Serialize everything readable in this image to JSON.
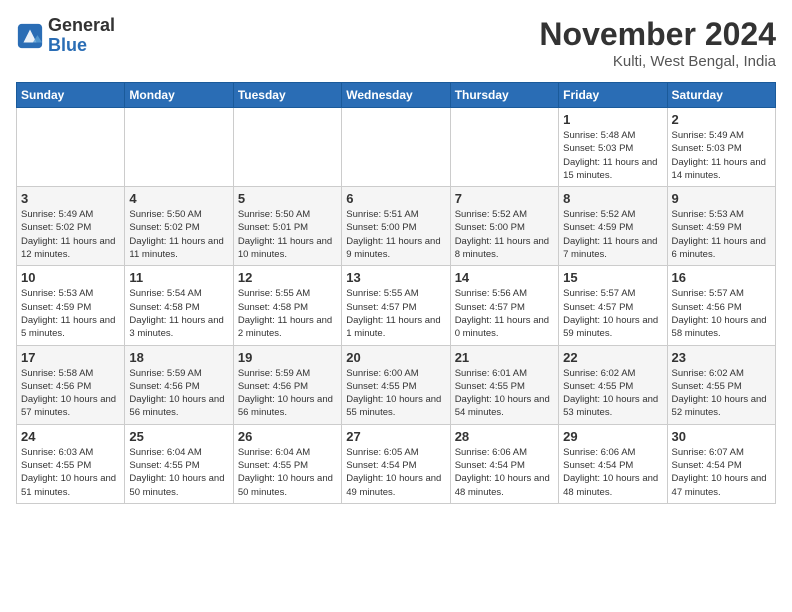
{
  "header": {
    "logo_general": "General",
    "logo_blue": "Blue",
    "title": "November 2024",
    "location": "Kulti, West Bengal, India"
  },
  "days_of_week": [
    "Sunday",
    "Monday",
    "Tuesday",
    "Wednesday",
    "Thursday",
    "Friday",
    "Saturday"
  ],
  "weeks": [
    [
      {
        "day": "",
        "info": ""
      },
      {
        "day": "",
        "info": ""
      },
      {
        "day": "",
        "info": ""
      },
      {
        "day": "",
        "info": ""
      },
      {
        "day": "",
        "info": ""
      },
      {
        "day": "1",
        "info": "Sunrise: 5:48 AM\nSunset: 5:03 PM\nDaylight: 11 hours and 15 minutes."
      },
      {
        "day": "2",
        "info": "Sunrise: 5:49 AM\nSunset: 5:03 PM\nDaylight: 11 hours and 14 minutes."
      }
    ],
    [
      {
        "day": "3",
        "info": "Sunrise: 5:49 AM\nSunset: 5:02 PM\nDaylight: 11 hours and 12 minutes."
      },
      {
        "day": "4",
        "info": "Sunrise: 5:50 AM\nSunset: 5:02 PM\nDaylight: 11 hours and 11 minutes."
      },
      {
        "day": "5",
        "info": "Sunrise: 5:50 AM\nSunset: 5:01 PM\nDaylight: 11 hours and 10 minutes."
      },
      {
        "day": "6",
        "info": "Sunrise: 5:51 AM\nSunset: 5:00 PM\nDaylight: 11 hours and 9 minutes."
      },
      {
        "day": "7",
        "info": "Sunrise: 5:52 AM\nSunset: 5:00 PM\nDaylight: 11 hours and 8 minutes."
      },
      {
        "day": "8",
        "info": "Sunrise: 5:52 AM\nSunset: 4:59 PM\nDaylight: 11 hours and 7 minutes."
      },
      {
        "day": "9",
        "info": "Sunrise: 5:53 AM\nSunset: 4:59 PM\nDaylight: 11 hours and 6 minutes."
      }
    ],
    [
      {
        "day": "10",
        "info": "Sunrise: 5:53 AM\nSunset: 4:59 PM\nDaylight: 11 hours and 5 minutes."
      },
      {
        "day": "11",
        "info": "Sunrise: 5:54 AM\nSunset: 4:58 PM\nDaylight: 11 hours and 3 minutes."
      },
      {
        "day": "12",
        "info": "Sunrise: 5:55 AM\nSunset: 4:58 PM\nDaylight: 11 hours and 2 minutes."
      },
      {
        "day": "13",
        "info": "Sunrise: 5:55 AM\nSunset: 4:57 PM\nDaylight: 11 hours and 1 minute."
      },
      {
        "day": "14",
        "info": "Sunrise: 5:56 AM\nSunset: 4:57 PM\nDaylight: 11 hours and 0 minutes."
      },
      {
        "day": "15",
        "info": "Sunrise: 5:57 AM\nSunset: 4:57 PM\nDaylight: 10 hours and 59 minutes."
      },
      {
        "day": "16",
        "info": "Sunrise: 5:57 AM\nSunset: 4:56 PM\nDaylight: 10 hours and 58 minutes."
      }
    ],
    [
      {
        "day": "17",
        "info": "Sunrise: 5:58 AM\nSunset: 4:56 PM\nDaylight: 10 hours and 57 minutes."
      },
      {
        "day": "18",
        "info": "Sunrise: 5:59 AM\nSunset: 4:56 PM\nDaylight: 10 hours and 56 minutes."
      },
      {
        "day": "19",
        "info": "Sunrise: 5:59 AM\nSunset: 4:56 PM\nDaylight: 10 hours and 56 minutes."
      },
      {
        "day": "20",
        "info": "Sunrise: 6:00 AM\nSunset: 4:55 PM\nDaylight: 10 hours and 55 minutes."
      },
      {
        "day": "21",
        "info": "Sunrise: 6:01 AM\nSunset: 4:55 PM\nDaylight: 10 hours and 54 minutes."
      },
      {
        "day": "22",
        "info": "Sunrise: 6:02 AM\nSunset: 4:55 PM\nDaylight: 10 hours and 53 minutes."
      },
      {
        "day": "23",
        "info": "Sunrise: 6:02 AM\nSunset: 4:55 PM\nDaylight: 10 hours and 52 minutes."
      }
    ],
    [
      {
        "day": "24",
        "info": "Sunrise: 6:03 AM\nSunset: 4:55 PM\nDaylight: 10 hours and 51 minutes."
      },
      {
        "day": "25",
        "info": "Sunrise: 6:04 AM\nSunset: 4:55 PM\nDaylight: 10 hours and 50 minutes."
      },
      {
        "day": "26",
        "info": "Sunrise: 6:04 AM\nSunset: 4:55 PM\nDaylight: 10 hours and 50 minutes."
      },
      {
        "day": "27",
        "info": "Sunrise: 6:05 AM\nSunset: 4:54 PM\nDaylight: 10 hours and 49 minutes."
      },
      {
        "day": "28",
        "info": "Sunrise: 6:06 AM\nSunset: 4:54 PM\nDaylight: 10 hours and 48 minutes."
      },
      {
        "day": "29",
        "info": "Sunrise: 6:06 AM\nSunset: 4:54 PM\nDaylight: 10 hours and 48 minutes."
      },
      {
        "day": "30",
        "info": "Sunrise: 6:07 AM\nSunset: 4:54 PM\nDaylight: 10 hours and 47 minutes."
      }
    ]
  ]
}
